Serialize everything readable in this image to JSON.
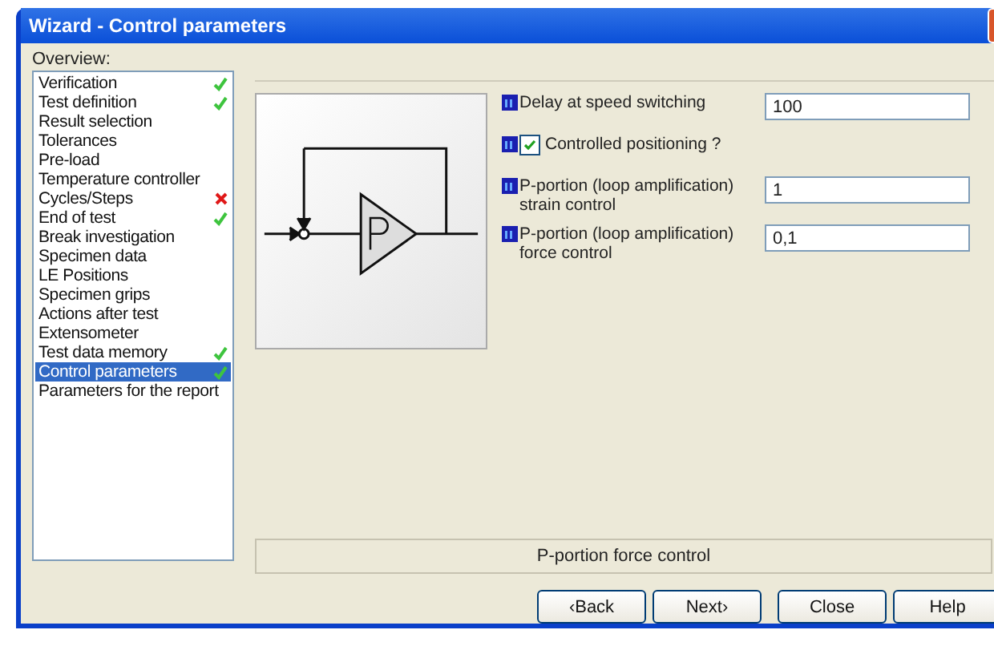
{
  "window": {
    "title": "Wizard - Control parameters"
  },
  "overview": {
    "label": "Overview:",
    "items": [
      {
        "label": "Verification",
        "selected": false,
        "done": true,
        "failed": false
      },
      {
        "label": "Test definition",
        "selected": false,
        "done": true,
        "failed": false
      },
      {
        "label": "Result selection",
        "selected": false,
        "done": false,
        "failed": false
      },
      {
        "label": "Tolerances",
        "selected": false,
        "done": false,
        "failed": false
      },
      {
        "label": "Pre-load",
        "selected": false,
        "done": false,
        "failed": false
      },
      {
        "label": "Temperature controller",
        "selected": false,
        "done": false,
        "failed": false
      },
      {
        "label": "Cycles/Steps",
        "selected": false,
        "done": false,
        "failed": true
      },
      {
        "label": "End of test",
        "selected": false,
        "done": true,
        "failed": false
      },
      {
        "label": "Break investigation",
        "selected": false,
        "done": false,
        "failed": false
      },
      {
        "label": "Specimen data",
        "selected": false,
        "done": false,
        "failed": false
      },
      {
        "label": "LE Positions",
        "selected": false,
        "done": false,
        "failed": false
      },
      {
        "label": "Specimen grips",
        "selected": false,
        "done": false,
        "failed": false
      },
      {
        "label": "Actions after test",
        "selected": false,
        "done": false,
        "failed": false
      },
      {
        "label": "Extensometer",
        "selected": false,
        "done": false,
        "failed": false
      },
      {
        "label": "Test data memory",
        "selected": false,
        "done": true,
        "failed": false
      },
      {
        "label": "Control parameters",
        "selected": true,
        "done": true,
        "failed": false
      },
      {
        "label": "Parameters for the report",
        "selected": false,
        "done": false,
        "failed": false
      }
    ]
  },
  "parameters": [
    {
      "kind": "field",
      "label": "Delay at speed switching",
      "value": "100"
    },
    {
      "kind": "checkbox",
      "label": "Controlled positioning ?",
      "checked": true
    },
    {
      "kind": "field",
      "label": "P-portion (loop amplification) strain control",
      "value": "1"
    },
    {
      "kind": "field",
      "label": "P-portion (loop amplification) force control",
      "value": "0,1"
    }
  ],
  "status_text": "P-portion force control",
  "buttons": [
    "‹Back",
    "Next›",
    "Close",
    "Help"
  ]
}
